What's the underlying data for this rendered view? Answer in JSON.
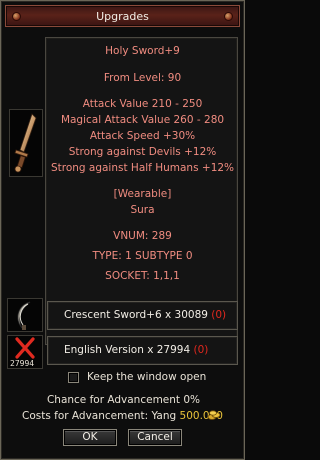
{
  "window": {
    "title": "Upgrades"
  },
  "item_info": {
    "lines": [
      "Holy Sword+9",
      "From Level: 90",
      "Attack Value 210 - 250",
      "Magical Attack Value 260 - 280",
      "Attack Speed +30%",
      "Strong against Devils +12%",
      "Strong against Half Humans +12%",
      "[Wearable]",
      "Sura",
      "VNUM: 289",
      "TYPE: 1 SUBTYPE 0",
      "SOCKET: 1,1,1"
    ]
  },
  "materials": [
    {
      "name": "Crescent Sword+6 x 30089",
      "count": "(0)",
      "icon": "crescent-sword-icon"
    },
    {
      "name": "English Version x 27994",
      "count": "(0)",
      "icon": "missing-item-icon",
      "icon_number": "27994"
    }
  ],
  "keep_open": {
    "label": "Keep the window open",
    "checked": false
  },
  "chance": "Chance for Advancement 0%",
  "cost": {
    "label": "Costs for Advancement: Yang ",
    "amount": "500.000"
  },
  "buttons": {
    "ok": "OK",
    "cancel": "Cancel"
  },
  "colors": {
    "stat_text": "#f08c80",
    "missing_count": "#e0281e",
    "yang": "#e8c23a"
  }
}
